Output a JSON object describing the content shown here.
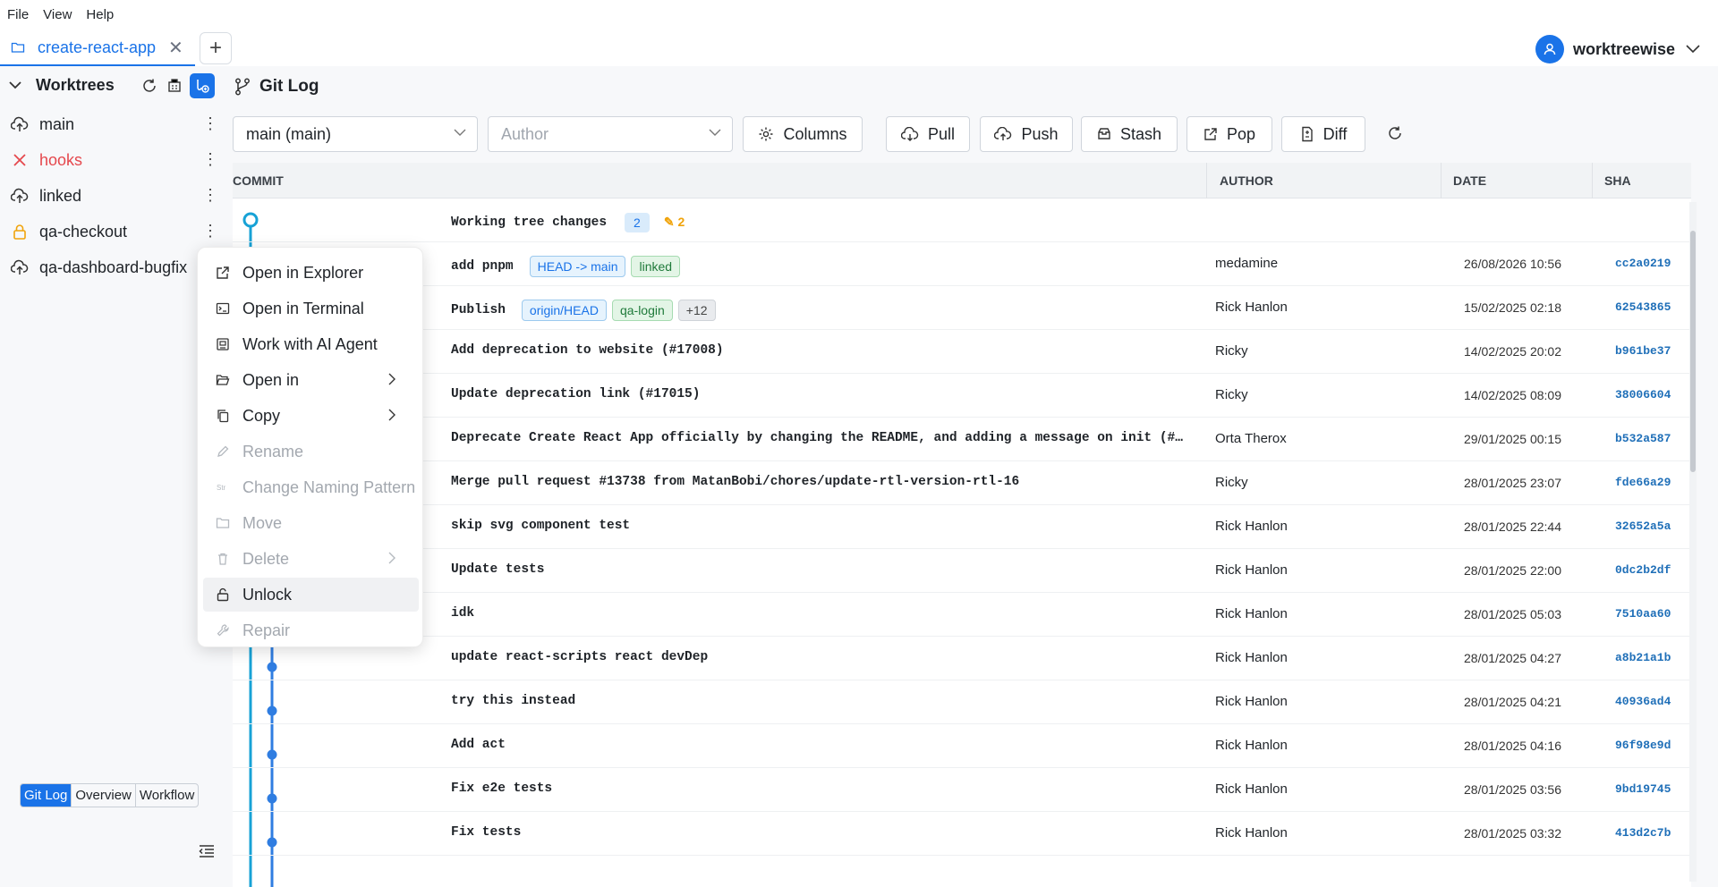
{
  "menubar": {
    "items": [
      "File",
      "View",
      "Help"
    ]
  },
  "tabs": {
    "active_label": "create-react-app",
    "new_tab": "+"
  },
  "user": {
    "name": "worktreewise"
  },
  "sidebar": {
    "section_title": "Worktrees",
    "worktrees": [
      {
        "name": "main",
        "icon": "cloud-upload-icon",
        "status": "normal"
      },
      {
        "name": "hooks",
        "icon": "x-icon",
        "status": "error"
      },
      {
        "name": "linked",
        "icon": "cloud-upload-icon",
        "status": "normal"
      },
      {
        "name": "qa-checkout",
        "icon": "lock-icon",
        "status": "locked"
      },
      {
        "name": "qa-dashboard-bugfix",
        "icon": "cloud-upload-icon",
        "status": "normal"
      }
    ],
    "views": [
      "Git Log",
      "Overview",
      "Workflow"
    ],
    "active_view": "Git Log"
  },
  "main": {
    "title": "Git Log",
    "branch_select": "main (main)",
    "author_placeholder": "Author",
    "buttons": {
      "columns": "Columns",
      "pull": "Pull",
      "push": "Push",
      "stash": "Stash",
      "pop": "Pop",
      "diff": "Diff"
    }
  },
  "table": {
    "headers": {
      "commit": "COMMIT",
      "author": "AUTHOR",
      "date": "DATE",
      "sha": "SHA"
    },
    "working": {
      "message": "Working tree changes",
      "count": "2",
      "edited": "2"
    },
    "rows": [
      {
        "message": "add pnpm",
        "author": "medamine",
        "date": "26/08/2026 10:56",
        "sha": "cc2a0219",
        "tags": [
          {
            "text": "HEAD -> main",
            "kind": "blue"
          },
          {
            "text": "linked",
            "kind": "green"
          }
        ]
      },
      {
        "message": "Publish",
        "author": "Rick Hanlon",
        "date": "15/02/2025 02:18",
        "sha": "62543865",
        "tags": [
          {
            "text": "origin/HEAD",
            "kind": "blue"
          },
          {
            "text": "qa-login",
            "kind": "green"
          },
          {
            "text": "+12",
            "kind": "gray"
          }
        ]
      },
      {
        "message": "Add deprecation to website (#17008)",
        "author": "Ricky",
        "date": "14/02/2025 20:02",
        "sha": "b961be37",
        "tags": []
      },
      {
        "message": "Update deprecation link (#17015)",
        "author": "Ricky",
        "date": "14/02/2025 08:09",
        "sha": "38006604",
        "tags": []
      },
      {
        "message": "Deprecate Create React App officially by changing the README, and adding a message on init (#…",
        "author": "Orta Therox",
        "date": "29/01/2025 00:15",
        "sha": "b532a587",
        "tags": []
      },
      {
        "message": "Merge pull request #13738 from MatanBobi/chores/update-rtl-version-rtl-16",
        "author": "Ricky",
        "date": "28/01/2025 23:07",
        "sha": "fde66a29",
        "tags": []
      },
      {
        "message": "skip svg component test",
        "author": "Rick Hanlon",
        "date": "28/01/2025 22:44",
        "sha": "32652a5a",
        "tags": []
      },
      {
        "message": "Update tests",
        "author": "Rick Hanlon",
        "date": "28/01/2025 22:00",
        "sha": "0dc2b2df",
        "tags": []
      },
      {
        "message": "idk",
        "author": "Rick Hanlon",
        "date": "28/01/2025 05:03",
        "sha": "7510aa60",
        "tags": []
      },
      {
        "message": "update react-scripts react devDep",
        "author": "Rick Hanlon",
        "date": "28/01/2025 04:27",
        "sha": "a8b21a1b",
        "tags": []
      },
      {
        "message": "try this instead",
        "author": "Rick Hanlon",
        "date": "28/01/2025 04:21",
        "sha": "40936ad4",
        "tags": []
      },
      {
        "message": "Add act",
        "author": "Rick Hanlon",
        "date": "28/01/2025 04:16",
        "sha": "96f98e9d",
        "tags": []
      },
      {
        "message": "Fix e2e tests",
        "author": "Rick Hanlon",
        "date": "28/01/2025 03:56",
        "sha": "9bd19745",
        "tags": []
      },
      {
        "message": "Fix tests",
        "author": "Rick Hanlon",
        "date": "28/01/2025 03:32",
        "sha": "413d2c7b",
        "tags": []
      }
    ]
  },
  "context_menu": {
    "items": [
      {
        "label": "Open in Explorer",
        "icon": "external-link-icon",
        "disabled": false,
        "submenu": false
      },
      {
        "label": "Open in Terminal",
        "icon": "terminal-icon",
        "disabled": false,
        "submenu": false
      },
      {
        "label": "Work with AI Agent",
        "icon": "agent-icon",
        "disabled": false,
        "submenu": false
      },
      {
        "label": "Open in",
        "icon": "folder-open-icon",
        "disabled": false,
        "submenu": true
      },
      {
        "label": "Copy",
        "icon": "copy-icon",
        "disabled": false,
        "submenu": true
      },
      {
        "label": "Rename",
        "icon": "pencil-icon",
        "disabled": true,
        "submenu": false
      },
      {
        "label": "Change Naming Pattern",
        "icon": "text-pattern-icon",
        "disabled": true,
        "submenu": false
      },
      {
        "label": "Move",
        "icon": "folder-move-icon",
        "disabled": true,
        "submenu": false
      },
      {
        "label": "Delete",
        "icon": "trash-icon",
        "disabled": true,
        "submenu": true
      },
      {
        "label": "Unlock",
        "icon": "unlock-icon",
        "disabled": false,
        "submenu": false,
        "hovered": true
      },
      {
        "label": "Repair",
        "icon": "wrench-icon",
        "disabled": true,
        "submenu": false
      }
    ]
  },
  "colors": {
    "accent": "#1a73e8",
    "error": "#e5484d",
    "lock": "#f0a30a",
    "graph_main": "#17a2d6",
    "graph_branch": "#2f7de1"
  }
}
